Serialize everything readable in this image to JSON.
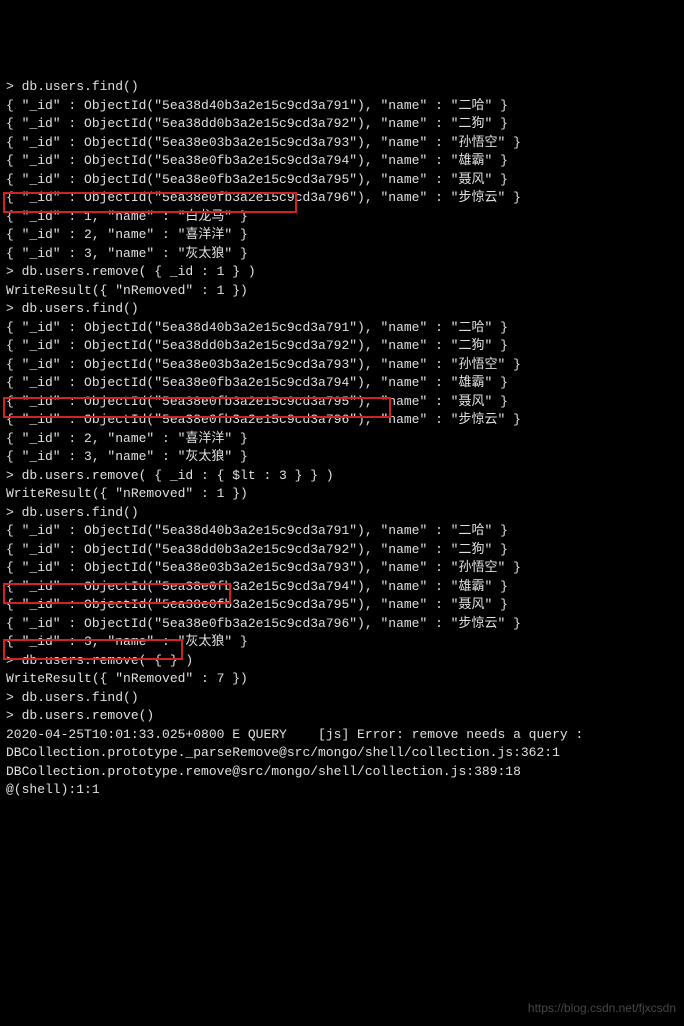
{
  "lines": [
    "> db.users.find()",
    "{ \"_id\" : ObjectId(\"5ea38d40b3a2e15c9cd3a791\"), \"name\" : \"二哈\" }",
    "{ \"_id\" : ObjectId(\"5ea38dd0b3a2e15c9cd3a792\"), \"name\" : \"二狗\" }",
    "{ \"_id\" : ObjectId(\"5ea38e03b3a2e15c9cd3a793\"), \"name\" : \"孙悟空\" }",
    "{ \"_id\" : ObjectId(\"5ea38e0fb3a2e15c9cd3a794\"), \"name\" : \"雄霸\" }",
    "{ \"_id\" : ObjectId(\"5ea38e0fb3a2e15c9cd3a795\"), \"name\" : \"聂风\" }",
    "{ \"_id\" : ObjectId(\"5ea38e0fb3a2e15c9cd3a796\"), \"name\" : \"步惊云\" }",
    "{ \"_id\" : 1, \"name\" : \"白龙马\" }",
    "{ \"_id\" : 2, \"name\" : \"喜洋洋\" }",
    "{ \"_id\" : 3, \"name\" : \"灰太狼\" }",
    "> db.users.remove( { _id : 1 } )",
    "WriteResult({ \"nRemoved\" : 1 })",
    "> db.users.find()",
    "{ \"_id\" : ObjectId(\"5ea38d40b3a2e15c9cd3a791\"), \"name\" : \"二哈\" }",
    "{ \"_id\" : ObjectId(\"5ea38dd0b3a2e15c9cd3a792\"), \"name\" : \"二狗\" }",
    "{ \"_id\" : ObjectId(\"5ea38e03b3a2e15c9cd3a793\"), \"name\" : \"孙悟空\" }",
    "{ \"_id\" : ObjectId(\"5ea38e0fb3a2e15c9cd3a794\"), \"name\" : \"雄霸\" }",
    "{ \"_id\" : ObjectId(\"5ea38e0fb3a2e15c9cd3a795\"), \"name\" : \"聂风\" }",
    "{ \"_id\" : ObjectId(\"5ea38e0fb3a2e15c9cd3a796\"), \"name\" : \"步惊云\" }",
    "{ \"_id\" : 2, \"name\" : \"喜洋洋\" }",
    "{ \"_id\" : 3, \"name\" : \"灰太狼\" }",
    "> db.users.remove( { _id : { $lt : 3 } } )",
    "WriteResult({ \"nRemoved\" : 1 })",
    "> db.users.find()",
    "{ \"_id\" : ObjectId(\"5ea38d40b3a2e15c9cd3a791\"), \"name\" : \"二哈\" }",
    "{ \"_id\" : ObjectId(\"5ea38dd0b3a2e15c9cd3a792\"), \"name\" : \"二狗\" }",
    "{ \"_id\" : ObjectId(\"5ea38e03b3a2e15c9cd3a793\"), \"name\" : \"孙悟空\" }",
    "{ \"_id\" : ObjectId(\"5ea38e0fb3a2e15c9cd3a794\"), \"name\" : \"雄霸\" }",
    "{ \"_id\" : ObjectId(\"5ea38e0fb3a2e15c9cd3a795\"), \"name\" : \"聂风\" }",
    "{ \"_id\" : ObjectId(\"5ea38e0fb3a2e15c9cd3a796\"), \"name\" : \"步惊云\" }",
    "{ \"_id\" : 3, \"name\" : \"灰太狼\" }",
    "> db.users.remove( { } )",
    "WriteResult({ \"nRemoved\" : 7 })",
    "> db.users.find()",
    "> db.users.remove()",
    "2020-04-25T10:01:33.025+0800 E QUERY    [js] Error: remove needs a query :",
    "DBCollection.prototype._parseRemove@src/mongo/shell/collection.js:362:1",
    "DBCollection.prototype.remove@src/mongo/shell/collection.js:389:18",
    "@(shell):1:1"
  ],
  "watermark": "https://blog.csdn.net/fjxcsdn"
}
